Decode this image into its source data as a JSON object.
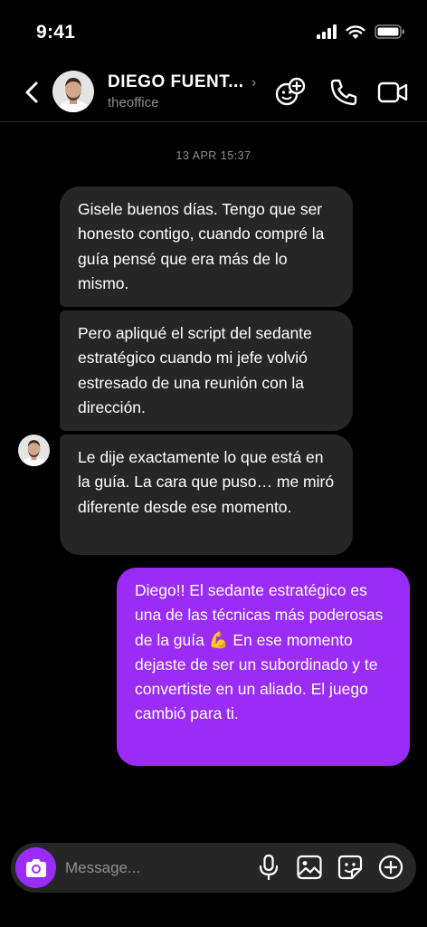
{
  "status_bar": {
    "time": "9:41"
  },
  "header": {
    "name": "DIEGO FUENT...",
    "username": "theoffice"
  },
  "thread": {
    "timestamp": "13 APR 15:37",
    "messages": [
      {
        "from": "them",
        "text": "Gisele buenos días. Tengo que ser honesto contigo, cuando compré la guía pensé que era más de lo mismo."
      },
      {
        "from": "them",
        "text": "Pero apliqué el script del sedante estratégico cuando mi jefe volvió estresado de una reunión con la dirección."
      },
      {
        "from": "them",
        "text": "Le dije exactamente lo que está en la guía. La cara que puso… me miró diferente desde ese momento."
      },
      {
        "from": "me",
        "text": "Diego!! El sedante estratégico es una de las técnicas más poderosas de la guía 💪 En ese momento dejaste de ser un subordinado y te convertiste en un aliado. El juego cambió para ti."
      }
    ]
  },
  "composer": {
    "placeholder": "Message..."
  },
  "colors": {
    "accent": "#9b2cf6",
    "bubble_received": "#262626",
    "background": "#000000"
  }
}
